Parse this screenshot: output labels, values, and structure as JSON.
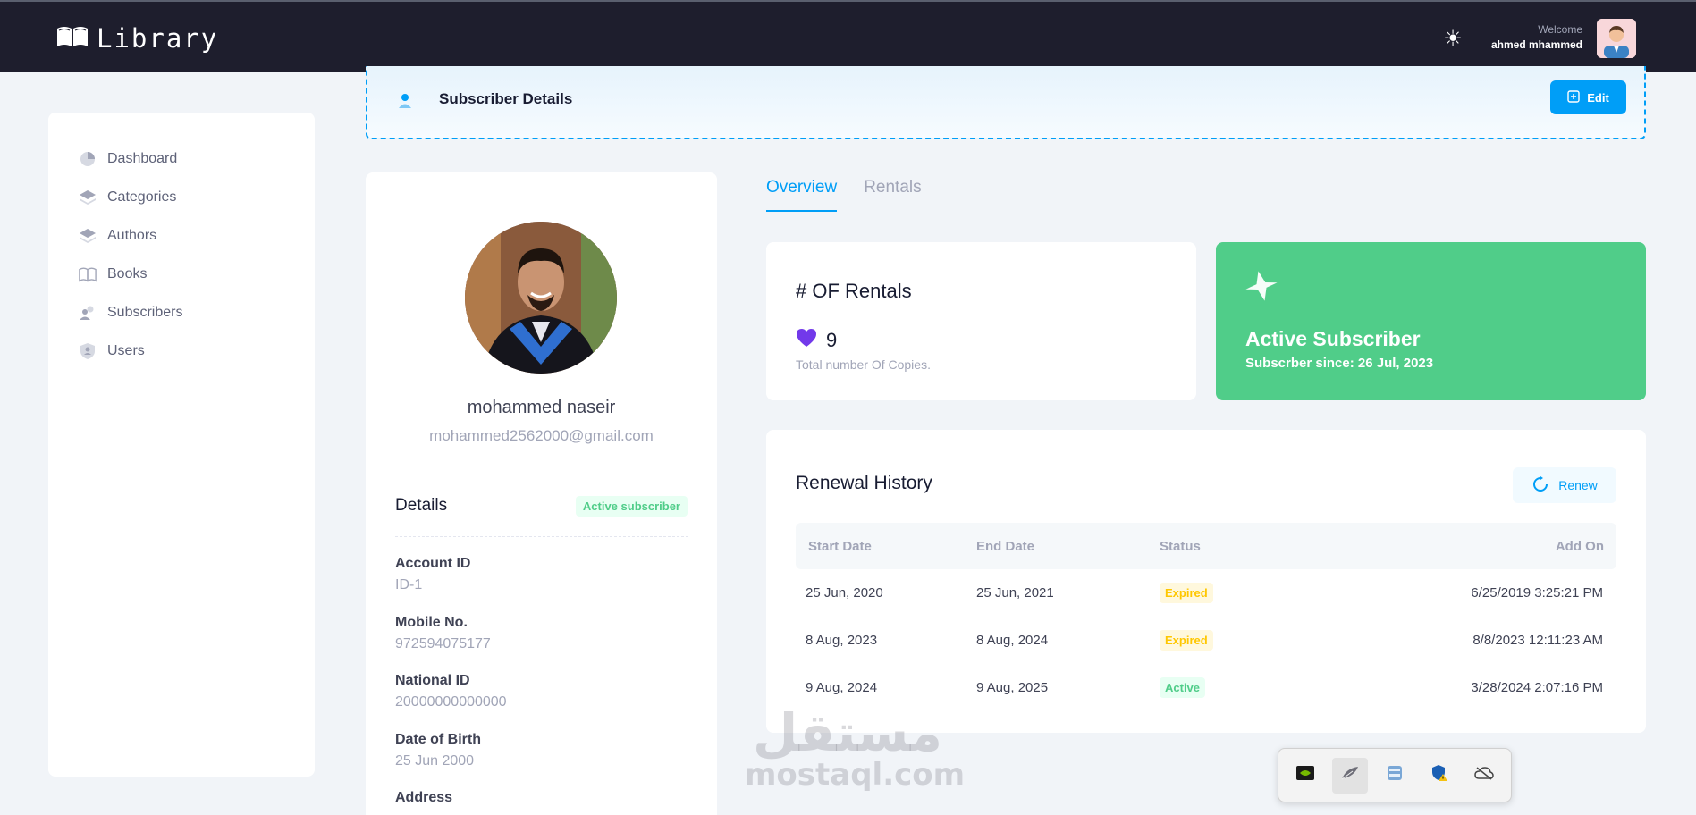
{
  "app": {
    "title": "Library"
  },
  "header": {
    "welcome_label": "Welcome",
    "user_name": "ahmed mhammed"
  },
  "sidebar": {
    "items": [
      {
        "label": "Dashboard",
        "icon": "pie-chart-icon"
      },
      {
        "label": "Categories",
        "icon": "layers-icon"
      },
      {
        "label": "Authors",
        "icon": "layers-icon"
      },
      {
        "label": "Books",
        "icon": "book-icon"
      },
      {
        "label": "Subscribers",
        "icon": "users-icon"
      },
      {
        "label": "Users",
        "icon": "shield-user-icon"
      }
    ]
  },
  "page_header": {
    "title": "Subscriber Details",
    "edit_label": "Edit"
  },
  "profile": {
    "name": "mohammed naseir",
    "email": "mohammed2562000@gmail.com",
    "details_title": "Details",
    "status_badge": "Active subscriber",
    "fields": [
      {
        "label": "Account ID",
        "value": "ID-1"
      },
      {
        "label": "Mobile No.",
        "value": "972594075177"
      },
      {
        "label": "National ID",
        "value": "20000000000000"
      },
      {
        "label": "Date of Birth",
        "value": "25 Jun 2000"
      },
      {
        "label": "Address",
        "value": ""
      }
    ]
  },
  "tabs": [
    {
      "label": "Overview",
      "active": true
    },
    {
      "label": "Rentals",
      "active": false
    }
  ],
  "rentals_card": {
    "title": "# OF Rentals",
    "count": "9",
    "description": "Total number Of Copies."
  },
  "subscriber_card": {
    "title": "Active Subscriber",
    "since": "Subscrber since: 26 Jul, 2023"
  },
  "renewal": {
    "title": "Renewal History",
    "renew_label": "Renew",
    "columns": [
      "Start Date",
      "End Date",
      "Status",
      "Add On"
    ],
    "rows": [
      {
        "start": "25 Jun, 2020",
        "end": "25 Jun, 2021",
        "status": "Expired",
        "added": "6/25/2019 3:25:21 PM"
      },
      {
        "start": "8 Aug, 2023",
        "end": "8 Aug, 2024",
        "status": "Expired",
        "added": "8/8/2023 12:11:23 AM"
      },
      {
        "start": "9 Aug, 2024",
        "end": "9 Aug, 2025",
        "status": "Active",
        "added": "3/28/2024 2:07:16 PM"
      }
    ]
  },
  "watermark": {
    "arabic": "مستقل",
    "latin": "mostaql.com"
  },
  "colors": {
    "primary": "#009ef7",
    "success": "#50cd89",
    "warning": "#ffc700",
    "topbar": "#1e1e2d"
  }
}
